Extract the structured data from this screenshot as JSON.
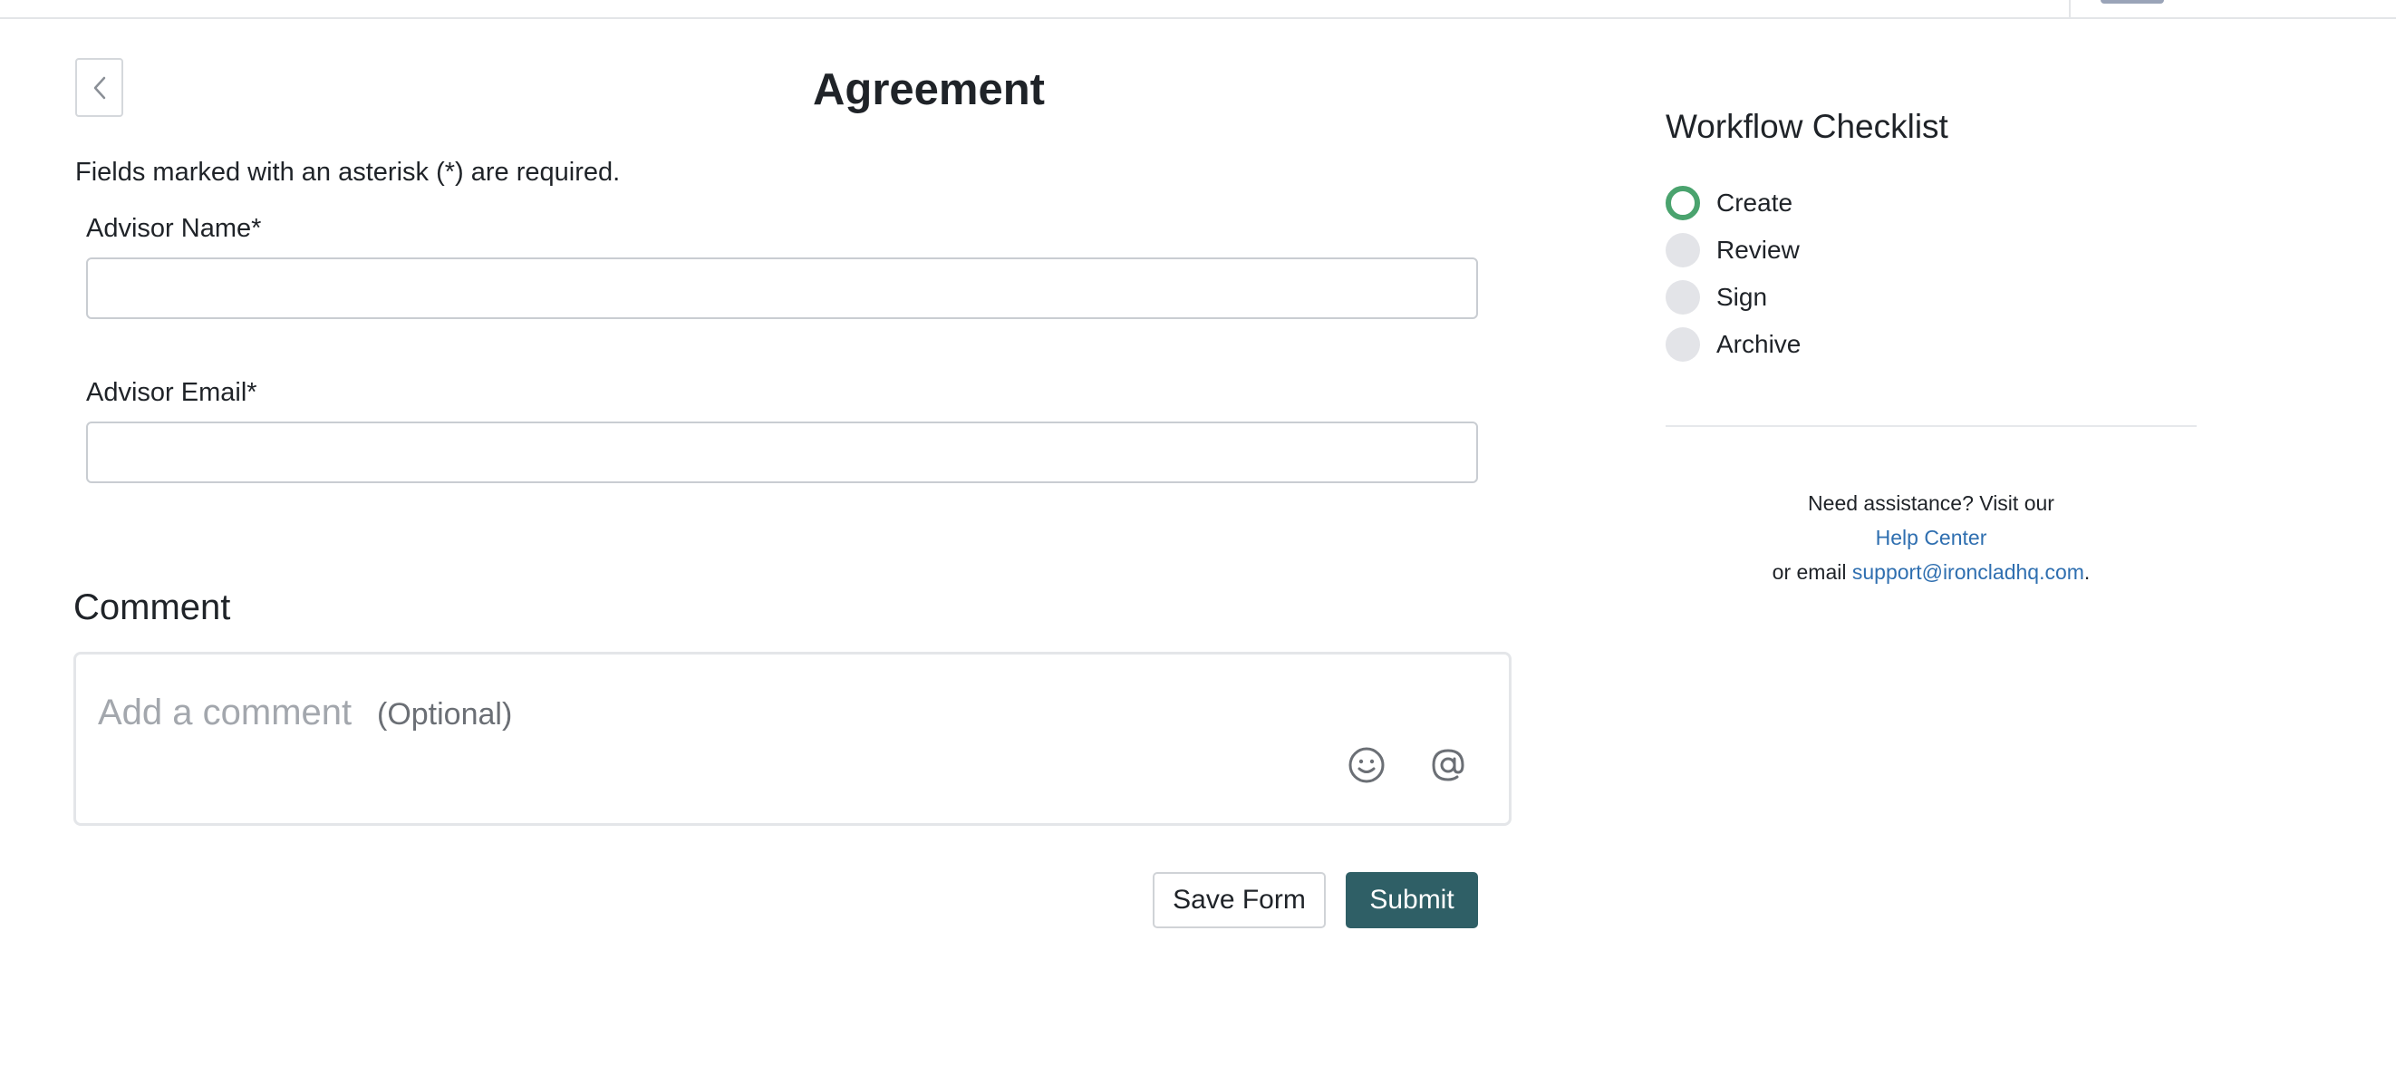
{
  "page": {
    "title": "Agreement",
    "required_note": "Fields marked with an asterisk (*) are required."
  },
  "form": {
    "advisor_name": {
      "label": "Advisor Name*",
      "value": "",
      "placeholder": ""
    },
    "advisor_email": {
      "label": "Advisor Email*",
      "value": "",
      "placeholder": ""
    }
  },
  "comment": {
    "heading": "Comment",
    "placeholder": "Add a comment",
    "optional_label": "(Optional)",
    "icons": [
      "smiley-icon",
      "at-mention-icon"
    ]
  },
  "actions": {
    "save_label": "Save Form",
    "submit_label": "Submit",
    "submit_color": "#2f5f66"
  },
  "checklist": {
    "title": "Workflow Checklist",
    "steps": [
      {
        "label": "Create",
        "status": "active"
      },
      {
        "label": "Review",
        "status": "pending"
      },
      {
        "label": "Sign",
        "status": "pending"
      },
      {
        "label": "Archive",
        "status": "pending"
      }
    ],
    "active_color": "#4aa36e"
  },
  "help": {
    "line1": "Need assistance? Visit our",
    "link_label": "Help Center",
    "line3_prefix": "or email",
    "email": "support@ironcladhq.com",
    "line3_suffix": ".",
    "link_color": "#2f6fb0"
  }
}
